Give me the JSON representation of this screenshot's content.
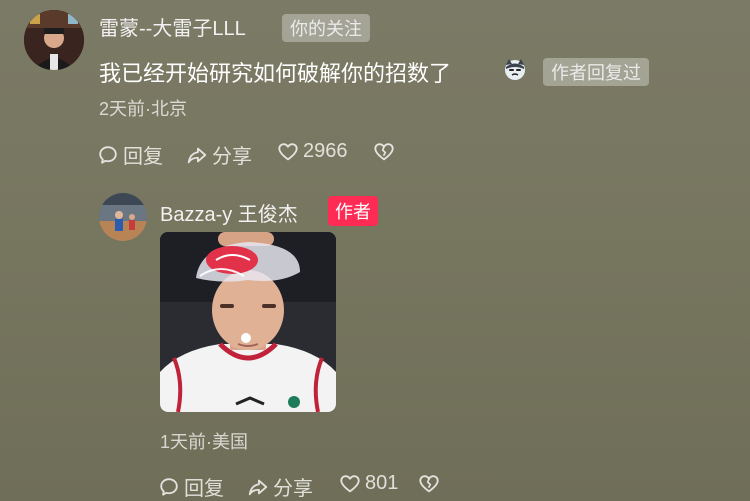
{
  "comment": {
    "username": "雷蒙--大雷子LLL",
    "follow_tag": "你的关注",
    "content": "我已经开始研究如何破解你的招数了",
    "emoji_icon": "cat-emoji-icon",
    "replied_tag": "作者回复过",
    "meta": "2天前·北京",
    "actions": {
      "reply_label": "回复",
      "share_label": "分享",
      "like_count": "2966"
    }
  },
  "reply": {
    "username": "Bazza-y 王俊杰",
    "author_badge": "作者",
    "meta": "1天前·美国",
    "actions": {
      "reply_label": "回复",
      "share_label": "分享",
      "like_count": "801"
    }
  },
  "colors": {
    "background": "#77765f",
    "author_badge": "#fe2c55",
    "tag_bg": "rgba(255,255,255,0.32)"
  },
  "icons": [
    "comment-icon",
    "share-icon",
    "heart-icon",
    "broken-heart-icon"
  ]
}
